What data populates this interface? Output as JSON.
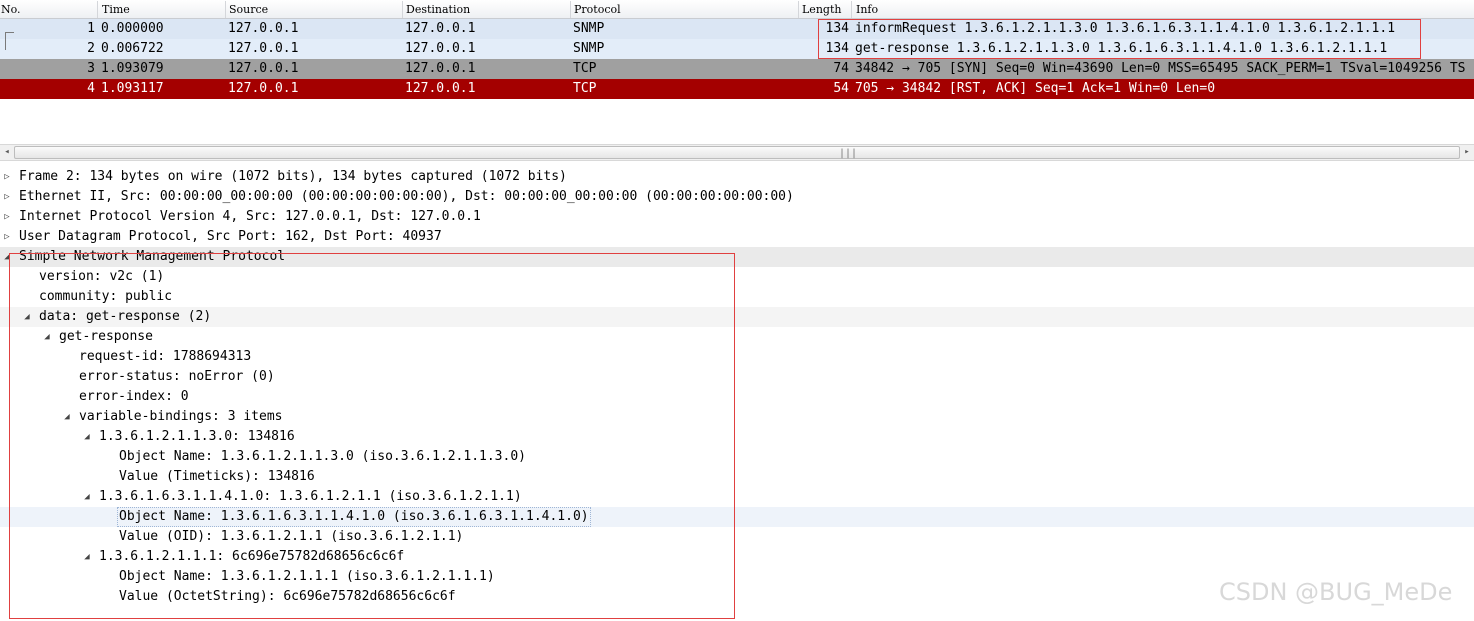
{
  "packet_list": {
    "columns": [
      "No.",
      "Time",
      "Source",
      "Destination",
      "Protocol",
      "Length",
      "Info"
    ],
    "rows": [
      {
        "no": "1",
        "time": "0.000000",
        "source": "127.0.0.1",
        "destination": "127.0.0.1",
        "protocol": "SNMP",
        "length": "134",
        "info": "informRequest 1.3.6.1.2.1.1.3.0 1.3.6.1.6.3.1.1.4.1.0 1.3.6.1.2.1.1.1"
      },
      {
        "no": "2",
        "time": "0.006722",
        "source": "127.0.0.1",
        "destination": "127.0.0.1",
        "protocol": "SNMP",
        "length": "134",
        "info": "get-response 1.3.6.1.2.1.1.3.0 1.3.6.1.6.3.1.1.4.1.0 1.3.6.1.2.1.1.1"
      },
      {
        "no": "3",
        "time": "1.093079",
        "source": "127.0.0.1",
        "destination": "127.0.0.1",
        "protocol": "TCP",
        "length": "74",
        "info": "34842 → 705 [SYN] Seq=0 Win=43690 Len=0 MSS=65495 SACK_PERM=1 TSval=1049256 TS"
      },
      {
        "no": "4",
        "time": "1.093117",
        "source": "127.0.0.1",
        "destination": "127.0.0.1",
        "protocol": "TCP",
        "length": "54",
        "info": "705 → 34842 [RST, ACK] Seq=1 Ack=1 Win=0 Len=0"
      }
    ],
    "row_colors": {
      "snmp": "#dbe6f4",
      "tcp_syn": "#a0a0a0",
      "tcp_rst": "#a40000"
    }
  },
  "scrollbar": {
    "grip": "|||"
  },
  "details": {
    "frame": "Frame 2: 134 bytes on wire (1072 bits), 134 bytes captured (1072 bits)",
    "ethernet": "Ethernet II, Src: 00:00:00_00:00:00 (00:00:00:00:00:00), Dst: 00:00:00_00:00:00 (00:00:00:00:00:00)",
    "ip": "Internet Protocol Version 4, Src: 127.0.0.1, Dst: 127.0.0.1",
    "udp": "User Datagram Protocol, Src Port: 162, Dst Port: 40937",
    "snmp": "Simple Network Management Protocol",
    "version": "version: v2c (1)",
    "community": "community: public",
    "data": "data: get-response (2)",
    "get_response": "get-response",
    "request_id": "request-id: 1788694313",
    "error_status": "error-status: noError (0)",
    "error_index": "error-index: 0",
    "variable_bindings": "variable-bindings: 3 items",
    "vb1": "1.3.6.1.2.1.1.3.0: 134816",
    "vb1_name": "Object Name: 1.3.6.1.2.1.1.3.0 (iso.3.6.1.2.1.1.3.0)",
    "vb1_value": "Value (Timeticks): 134816",
    "vb2": "1.3.6.1.6.3.1.1.4.1.0: 1.3.6.1.2.1.1 (iso.3.6.1.2.1.1)",
    "vb2_name": "Object Name: 1.3.6.1.6.3.1.1.4.1.0 (iso.3.6.1.6.3.1.1.4.1.0)",
    "vb2_value": "Value (OID): 1.3.6.1.2.1.1 (iso.3.6.1.2.1.1)",
    "vb3": "1.3.6.1.2.1.1.1: 6c696e75782d68656c6c6f",
    "vb3_name": "Object Name: 1.3.6.1.2.1.1.1 (iso.3.6.1.2.1.1.1)",
    "vb3_value": "Value (OctetString): 6c696e75782d68656c6c6f"
  },
  "icons": {
    "collapsed": "▷",
    "expanded": "◢"
  },
  "watermark": "CSDN @BUG_MeDe",
  "highlight_color": "#e04040"
}
